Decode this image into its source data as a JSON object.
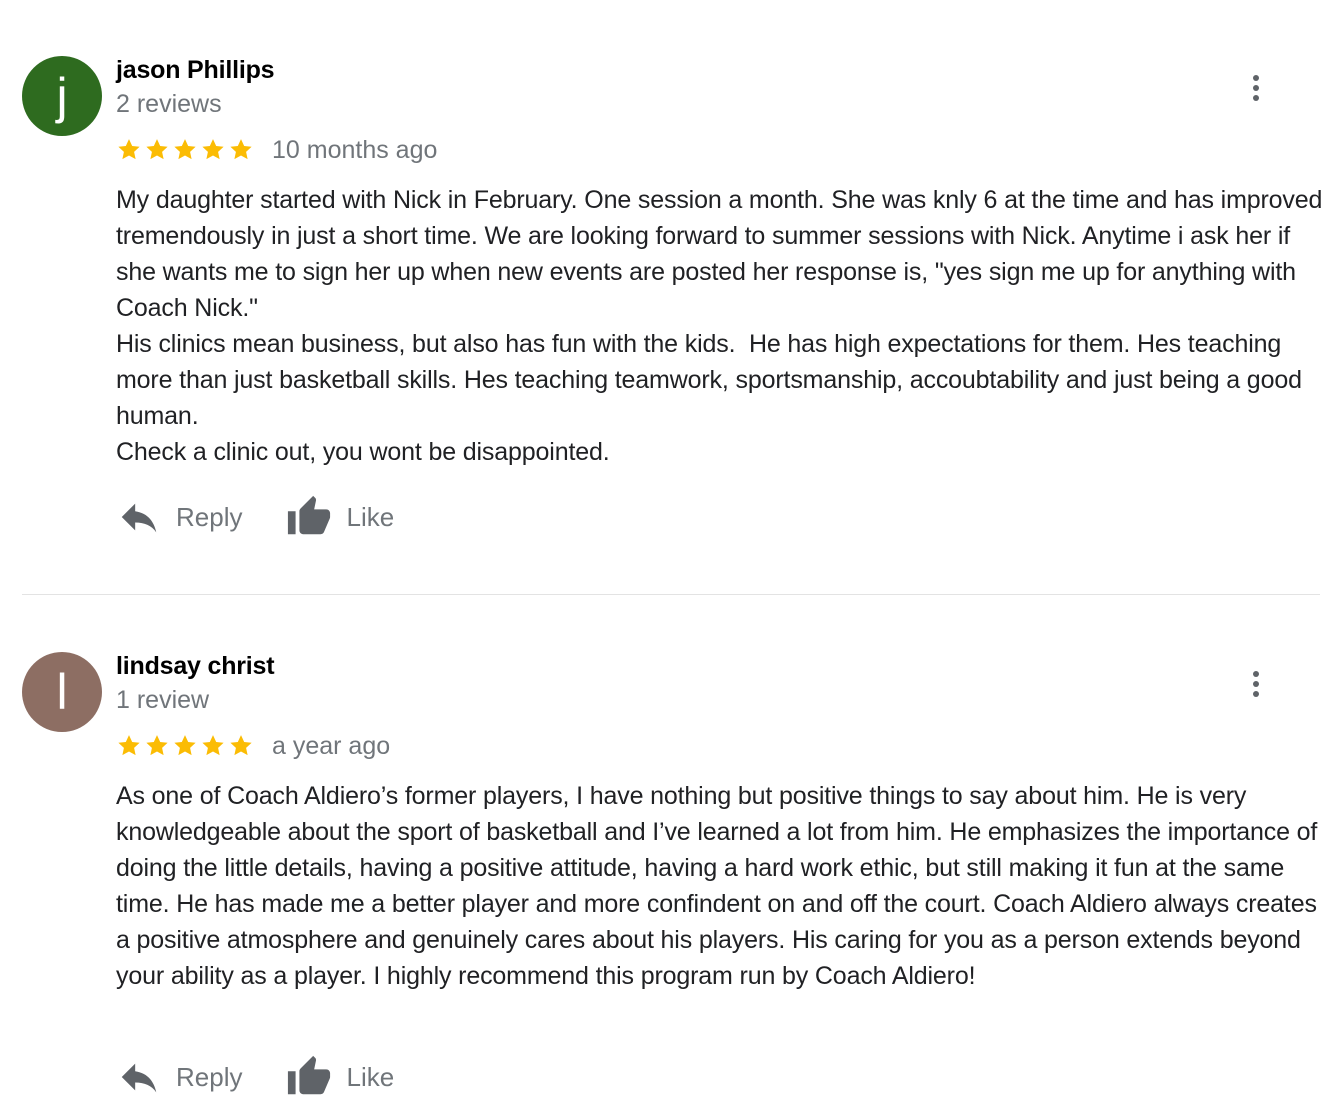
{
  "reviews": [
    {
      "avatar_letter": "j",
      "avatar_color": "#2e6b1f",
      "name": "jason Phillips",
      "review_count": "2 reviews",
      "stars": 5,
      "date": "10 months ago",
      "body": [
        "My daughter started with Nick in February. One session a month. She was knly 6 at the time and has improved tremendously in just a short time. We are looking forward to summer sessions with Nick. Anytime i ask her if she wants me to sign her up when new events are posted her response is, \"yes sign me up for anything with Coach Nick.\"",
        "His clinics mean business, but also has fun with the kids.  He has high expectations for them. Hes teaching more than just basketball skills. Hes teaching teamwork, sportsmanship, accoubtability and just being a good human.",
        "Check a clinic out, you wont be disappointed."
      ],
      "reply_label": "Reply",
      "like_label": "Like"
    },
    {
      "avatar_letter": "l",
      "avatar_color": "#8d6e63",
      "name": "lindsay christ",
      "review_count": "1 review",
      "stars": 5,
      "date": "a year ago",
      "body": [
        "As one of Coach Aldiero’s former players, I have nothing but positive things to say about him. He is very knowledgeable about the sport of basketball and I’ve learned a lot from him. He emphasizes the importance of doing the little details, having a positive attitude, having a hard work ethic, but still making it fun at the same time. He has made me a better player and more confindent on and off the court. Coach Aldiero always creates a positive atmosphere and genuinely cares about his players. His caring for you as a person extends beyond your ability as a player. I highly recommend this program run by Coach Aldiero!"
      ],
      "reply_label": "Reply",
      "like_label": "Like"
    }
  ],
  "colors": {
    "star": "#fbbc04",
    "secondary_text": "#70757a",
    "icon": "#5f6368",
    "divider": "#e3e3e3"
  },
  "icons": {
    "menu": "more-vert-icon",
    "reply": "reply-arrow-icon",
    "like": "thumbs-up-icon",
    "star": "star-icon"
  }
}
